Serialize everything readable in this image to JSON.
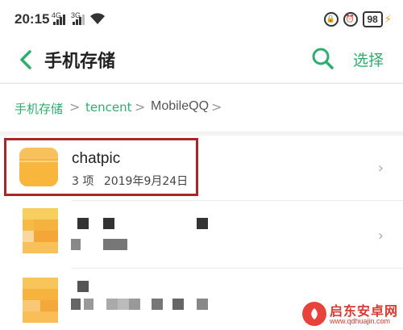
{
  "status_bar": {
    "time": "20:15",
    "signal1": "4G",
    "signal2": "3G",
    "battery": "98"
  },
  "toolbar": {
    "title": "手机存储",
    "select_label": "选择"
  },
  "breadcrumb": {
    "items": [
      "手机存储",
      "tencent",
      "MobileQQ"
    ],
    "separator": ">"
  },
  "files": [
    {
      "name": "chatpic",
      "count": "3 项",
      "date": "2019年9月24日"
    }
  ],
  "watermark": {
    "name": "启东安卓网",
    "url": "www.qdhuajin.com"
  },
  "colors": {
    "accent": "#2eae6e",
    "highlight_border": "#a8252a",
    "folder": "#f7b43a"
  }
}
